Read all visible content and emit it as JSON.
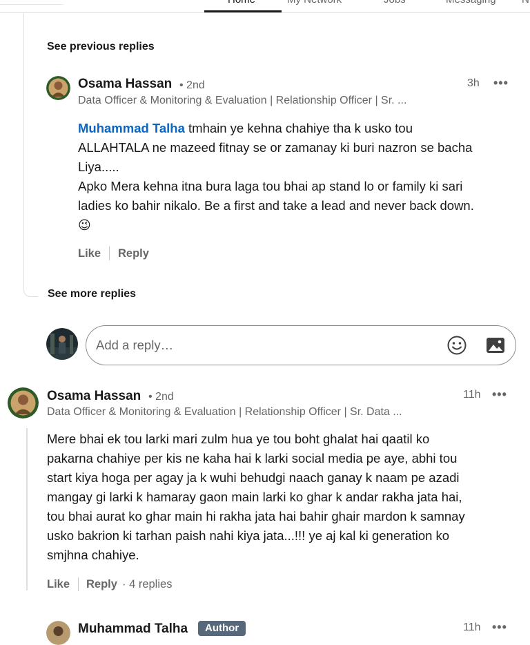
{
  "nav": {
    "items": [
      "Home",
      "My Network",
      "Jobs",
      "Messaging",
      "N"
    ],
    "active": "Home"
  },
  "thread": {
    "see_previous": "See previous replies",
    "see_more": "See more replies"
  },
  "reply1": {
    "author": "Osama Hassan",
    "degree": "• 2nd",
    "headline": "Data Officer & Monitoring & Evaluation | Relationship Officer | Sr. ...",
    "time": "3h",
    "menu": "•••",
    "mention": "Muhammad Talha",
    "line1_rest": " tmhain ye kehna chahiye tha k usko tou",
    "lines": [
      "ALLAHTALA ne mazeed fitnay se or zamanay ki buri nazron se bacha",
      "Liya.....",
      "Apko Mera kehna itna bura laga tou bhai ap stand lo or family ki sari",
      "ladies ko bahir nikalo. Be a first and take a lead and never back down."
    ],
    "emoji": "😉",
    "like": "Like",
    "reply": "Reply"
  },
  "composer": {
    "placeholder": "Add a reply…",
    "emoji_icon": "emoji-icon",
    "image_icon": "image-icon"
  },
  "comment2": {
    "author": "Osama Hassan",
    "degree": "• 2nd",
    "headline": "Data Officer & Monitoring & Evaluation | Relationship Officer | Sr. Data ...",
    "time": "11h",
    "menu": "•••",
    "lines": [
      "Mere bhai ek tou larki mari zulm hua ye tou boht ghalat hai qaatil ko",
      "pakarna chahiye per kis ne kaha hai k larki social media pe aye, abhi tou",
      "start kiya hoga per agay ja k wuhi behudgi naach ganay k naam pe azadi",
      "mangay gi larki k hamaray gaon main larki ko ghar k andar rakha jata hai,",
      "tou bhai aurat ko ghar main hi rakha jata hai bahir ghair mardon k samnay",
      "usko bakrion ki tarhan paish nahi kiya jata...!!! ye aj kal ki generation ko",
      "smjhna chahiye."
    ],
    "like": "Like",
    "reply": "Reply",
    "replies_count": "· 4 replies"
  },
  "reply3": {
    "author": "Muhammad Talha",
    "badge": "Author",
    "time": "11h",
    "menu": "•••"
  }
}
